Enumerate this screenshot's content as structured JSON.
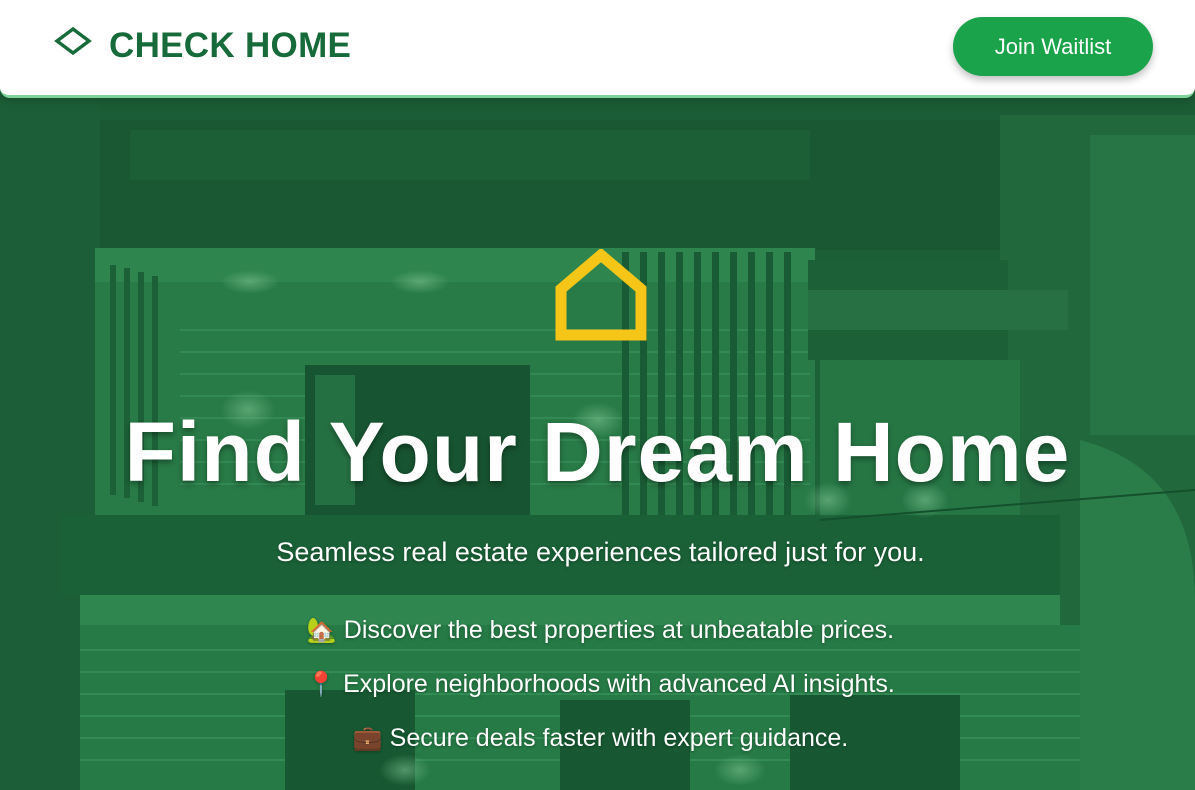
{
  "header": {
    "brand_name": "CHECK HOME",
    "cta_label": "Join Waitlist"
  },
  "hero": {
    "title": "Find Your Dream Home",
    "subtitle": "Seamless real estate experiences tailored just for you.",
    "features": [
      {
        "icon": "house-with-garden-emoji",
        "emoji": "🏡",
        "text": "Discover the best properties at unbeatable prices."
      },
      {
        "icon": "round-pushpin-emoji",
        "emoji": "📍",
        "text": "Explore neighborhoods with advanced AI insights."
      },
      {
        "icon": "briefcase-emoji",
        "emoji": "💼",
        "text": "Secure deals faster with expert guidance."
      }
    ]
  },
  "colors": {
    "brand_green": "#176b3a",
    "cta_green": "#1aa34a",
    "hero_overlay": "#1e7a40",
    "accent_yellow": "#f5c518",
    "header_border": "#7ed39a"
  }
}
